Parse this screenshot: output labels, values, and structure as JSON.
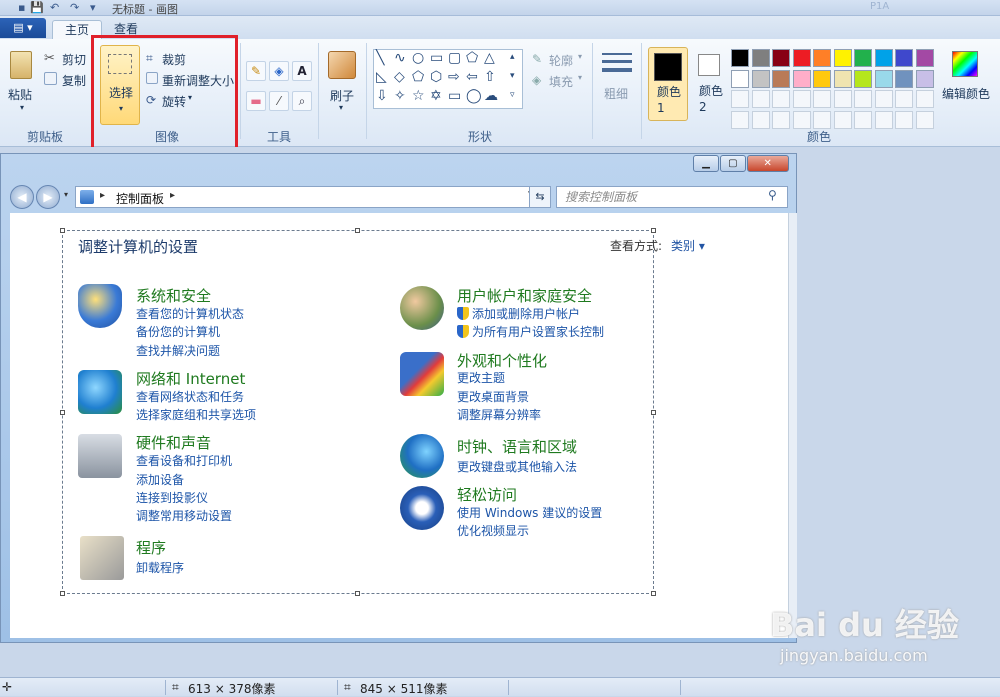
{
  "titlebar": {
    "title": "无标题 - 画图",
    "ghost": "P1A"
  },
  "tabs": {
    "file": "▤ ▾",
    "home": "主页",
    "view": "查看"
  },
  "ribbon": {
    "clipboard": {
      "paste": "粘贴",
      "cut": "剪切",
      "copy": "复制",
      "label": "剪贴板"
    },
    "image": {
      "select": "选择",
      "crop": "裁剪",
      "resize": "重新调整大小",
      "rotate": "旋转",
      "label": "图像"
    },
    "tools": {
      "label": "工具"
    },
    "brushes": {
      "label": "刷子"
    },
    "shapes": {
      "outline": "轮廓",
      "fill": "填充",
      "label": "形状"
    },
    "size": {
      "label": "粗细"
    },
    "colors": {
      "color1": "颜色 1",
      "color2": "颜色 2",
      "edit": "编辑颜色",
      "label": "颜色",
      "palette_row1": [
        "#000000",
        "#7f7f7f",
        "#880015",
        "#ed1c24",
        "#ff7f27",
        "#fff200",
        "#22b14c",
        "#00a2e8",
        "#3f48cc",
        "#a349a4"
      ],
      "palette_row2": [
        "#ffffff",
        "#c3c3c3",
        "#b97a57",
        "#ffaec9",
        "#ffc90e",
        "#efe4b0",
        "#b5e61d",
        "#99d9ea",
        "#7092be",
        "#c8bfe7"
      ]
    }
  },
  "window": {
    "address": "控制面板",
    "search_placeholder": "搜索控制面板",
    "page_title": "调整计算机的设置",
    "view_by": "查看方式:",
    "view_value": "类别 ▾"
  },
  "categories": {
    "security": {
      "title": "系统和安全",
      "links": [
        "查看您的计算机状态",
        "备份您的计算机",
        "查找并解决问题"
      ]
    },
    "network": {
      "title": "网络和 Internet",
      "links": [
        "查看网络状态和任务",
        "选择家庭组和共享选项"
      ]
    },
    "hardware": {
      "title": "硬件和声音",
      "links": [
        "查看设备和打印机",
        "添加设备",
        "连接到投影仪",
        "调整常用移动设置"
      ]
    },
    "programs": {
      "title": "程序",
      "links": [
        "卸载程序"
      ]
    },
    "users": {
      "title": "用户帐户和家庭安全",
      "links": [
        "添加或删除用户帐户",
        "为所有用户设置家长控制"
      ]
    },
    "appearance": {
      "title": "外观和个性化",
      "links": [
        "更改主题",
        "更改桌面背景",
        "调整屏幕分辨率"
      ]
    },
    "clock": {
      "title": "时钟、语言和区域",
      "links": [
        "更改键盘或其他输入法"
      ]
    },
    "ease": {
      "title": "轻松访问",
      "links": [
        "使用 Windows 建议的设置",
        "优化视频显示"
      ]
    }
  },
  "statusbar": {
    "selection_size": "613 × 378像素",
    "image_size": "845 × 511像素"
  },
  "watermark": {
    "main": "Bai du 经验",
    "sub": "jingyan.baidu.com"
  }
}
